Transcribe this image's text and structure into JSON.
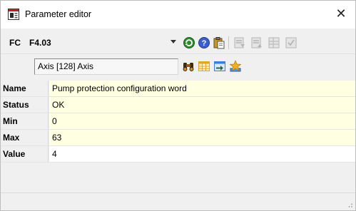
{
  "window": {
    "title": "Parameter editor",
    "icon": "parameter-editor-icon",
    "close_icon": "close-icon"
  },
  "address_bar": {
    "prefix": "FC",
    "address": "F4.03",
    "toolbar": [
      {
        "name": "refresh-icon",
        "color": "#2e8b2e"
      },
      {
        "name": "help-icon",
        "color": "#3a5fcd"
      },
      {
        "name": "clipboard-icon",
        "color": "#c9962b"
      },
      {
        "name": "write-disabled-icon",
        "color": "#b5b5b5"
      },
      {
        "name": "read-disabled-icon",
        "color": "#b5b5b5"
      },
      {
        "name": "table-disabled-icon",
        "color": "#b5b5b5"
      },
      {
        "name": "check-disabled-icon",
        "color": "#b5b5b5"
      }
    ]
  },
  "axis_bar": {
    "axis_value": "Axis [128] Axis",
    "tools": [
      {
        "name": "binoculars-icon",
        "color": "#8a5a1c"
      },
      {
        "name": "grid-icon",
        "color": "#e2a52c"
      },
      {
        "name": "import-icon",
        "color": "#3a7fd8"
      },
      {
        "name": "star-icon",
        "color": "#f0b020"
      }
    ]
  },
  "properties": [
    {
      "label": "Name",
      "value": "Pump protection configuration word",
      "editable": false
    },
    {
      "label": "Status",
      "value": "OK",
      "editable": false
    },
    {
      "label": "Min",
      "value": "0",
      "editable": false
    },
    {
      "label": "Max",
      "value": "63",
      "editable": false
    },
    {
      "label": "Value",
      "value": "4",
      "editable": true
    }
  ],
  "colors": {
    "readonly_bg": "#ffffe1",
    "editable_bg": "#ffffff",
    "label_bg": "#f0f0f0"
  }
}
